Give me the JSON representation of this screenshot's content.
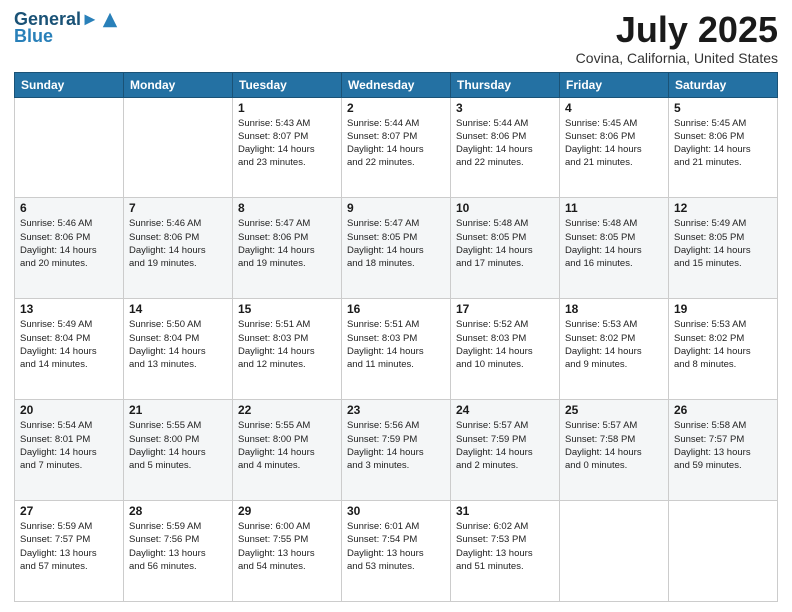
{
  "header": {
    "logo_line1": "General",
    "logo_line2": "Blue",
    "month": "July 2025",
    "location": "Covina, California, United States"
  },
  "days_of_week": [
    "Sunday",
    "Monday",
    "Tuesday",
    "Wednesday",
    "Thursday",
    "Friday",
    "Saturday"
  ],
  "weeks": [
    [
      {
        "day": "",
        "detail": ""
      },
      {
        "day": "",
        "detail": ""
      },
      {
        "day": "1",
        "detail": "Sunrise: 5:43 AM\nSunset: 8:07 PM\nDaylight: 14 hours\nand 23 minutes."
      },
      {
        "day": "2",
        "detail": "Sunrise: 5:44 AM\nSunset: 8:07 PM\nDaylight: 14 hours\nand 22 minutes."
      },
      {
        "day": "3",
        "detail": "Sunrise: 5:44 AM\nSunset: 8:06 PM\nDaylight: 14 hours\nand 22 minutes."
      },
      {
        "day": "4",
        "detail": "Sunrise: 5:45 AM\nSunset: 8:06 PM\nDaylight: 14 hours\nand 21 minutes."
      },
      {
        "day": "5",
        "detail": "Sunrise: 5:45 AM\nSunset: 8:06 PM\nDaylight: 14 hours\nand 21 minutes."
      }
    ],
    [
      {
        "day": "6",
        "detail": "Sunrise: 5:46 AM\nSunset: 8:06 PM\nDaylight: 14 hours\nand 20 minutes."
      },
      {
        "day": "7",
        "detail": "Sunrise: 5:46 AM\nSunset: 8:06 PM\nDaylight: 14 hours\nand 19 minutes."
      },
      {
        "day": "8",
        "detail": "Sunrise: 5:47 AM\nSunset: 8:06 PM\nDaylight: 14 hours\nand 19 minutes."
      },
      {
        "day": "9",
        "detail": "Sunrise: 5:47 AM\nSunset: 8:05 PM\nDaylight: 14 hours\nand 18 minutes."
      },
      {
        "day": "10",
        "detail": "Sunrise: 5:48 AM\nSunset: 8:05 PM\nDaylight: 14 hours\nand 17 minutes."
      },
      {
        "day": "11",
        "detail": "Sunrise: 5:48 AM\nSunset: 8:05 PM\nDaylight: 14 hours\nand 16 minutes."
      },
      {
        "day": "12",
        "detail": "Sunrise: 5:49 AM\nSunset: 8:05 PM\nDaylight: 14 hours\nand 15 minutes."
      }
    ],
    [
      {
        "day": "13",
        "detail": "Sunrise: 5:49 AM\nSunset: 8:04 PM\nDaylight: 14 hours\nand 14 minutes."
      },
      {
        "day": "14",
        "detail": "Sunrise: 5:50 AM\nSunset: 8:04 PM\nDaylight: 14 hours\nand 13 minutes."
      },
      {
        "day": "15",
        "detail": "Sunrise: 5:51 AM\nSunset: 8:03 PM\nDaylight: 14 hours\nand 12 minutes."
      },
      {
        "day": "16",
        "detail": "Sunrise: 5:51 AM\nSunset: 8:03 PM\nDaylight: 14 hours\nand 11 minutes."
      },
      {
        "day": "17",
        "detail": "Sunrise: 5:52 AM\nSunset: 8:03 PM\nDaylight: 14 hours\nand 10 minutes."
      },
      {
        "day": "18",
        "detail": "Sunrise: 5:53 AM\nSunset: 8:02 PM\nDaylight: 14 hours\nand 9 minutes."
      },
      {
        "day": "19",
        "detail": "Sunrise: 5:53 AM\nSunset: 8:02 PM\nDaylight: 14 hours\nand 8 minutes."
      }
    ],
    [
      {
        "day": "20",
        "detail": "Sunrise: 5:54 AM\nSunset: 8:01 PM\nDaylight: 14 hours\nand 7 minutes."
      },
      {
        "day": "21",
        "detail": "Sunrise: 5:55 AM\nSunset: 8:00 PM\nDaylight: 14 hours\nand 5 minutes."
      },
      {
        "day": "22",
        "detail": "Sunrise: 5:55 AM\nSunset: 8:00 PM\nDaylight: 14 hours\nand 4 minutes."
      },
      {
        "day": "23",
        "detail": "Sunrise: 5:56 AM\nSunset: 7:59 PM\nDaylight: 14 hours\nand 3 minutes."
      },
      {
        "day": "24",
        "detail": "Sunrise: 5:57 AM\nSunset: 7:59 PM\nDaylight: 14 hours\nand 2 minutes."
      },
      {
        "day": "25",
        "detail": "Sunrise: 5:57 AM\nSunset: 7:58 PM\nDaylight: 14 hours\nand 0 minutes."
      },
      {
        "day": "26",
        "detail": "Sunrise: 5:58 AM\nSunset: 7:57 PM\nDaylight: 13 hours\nand 59 minutes."
      }
    ],
    [
      {
        "day": "27",
        "detail": "Sunrise: 5:59 AM\nSunset: 7:57 PM\nDaylight: 13 hours\nand 57 minutes."
      },
      {
        "day": "28",
        "detail": "Sunrise: 5:59 AM\nSunset: 7:56 PM\nDaylight: 13 hours\nand 56 minutes."
      },
      {
        "day": "29",
        "detail": "Sunrise: 6:00 AM\nSunset: 7:55 PM\nDaylight: 13 hours\nand 54 minutes."
      },
      {
        "day": "30",
        "detail": "Sunrise: 6:01 AM\nSunset: 7:54 PM\nDaylight: 13 hours\nand 53 minutes."
      },
      {
        "day": "31",
        "detail": "Sunrise: 6:02 AM\nSunset: 7:53 PM\nDaylight: 13 hours\nand 51 minutes."
      },
      {
        "day": "",
        "detail": ""
      },
      {
        "day": "",
        "detail": ""
      }
    ]
  ]
}
